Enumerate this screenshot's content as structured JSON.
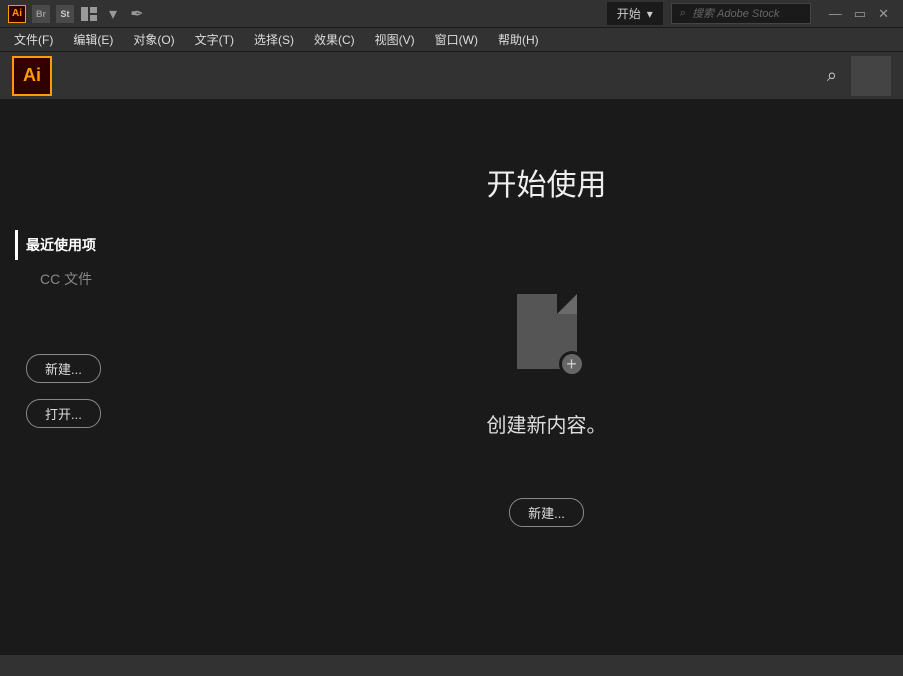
{
  "titlebar": {
    "ai_label": "Ai",
    "br_label": "Br",
    "st_label": "St",
    "start_dropdown": "开始",
    "search_placeholder": "搜索 Adobe Stock"
  },
  "menu": {
    "items": [
      "文件(F)",
      "编辑(E)",
      "对象(O)",
      "文字(T)",
      "选择(S)",
      "效果(C)",
      "视图(V)",
      "窗口(W)",
      "帮助(H)"
    ]
  },
  "toolbar": {
    "ai_label": "Ai"
  },
  "sidebar": {
    "nav": {
      "recent": "最近使用项",
      "cc_files": "CC 文件"
    },
    "actions": {
      "new_btn": "新建...",
      "open_btn": "打开..."
    }
  },
  "content": {
    "title": "开始使用",
    "subtitle": "创建新内容。",
    "new_btn": "新建..."
  }
}
